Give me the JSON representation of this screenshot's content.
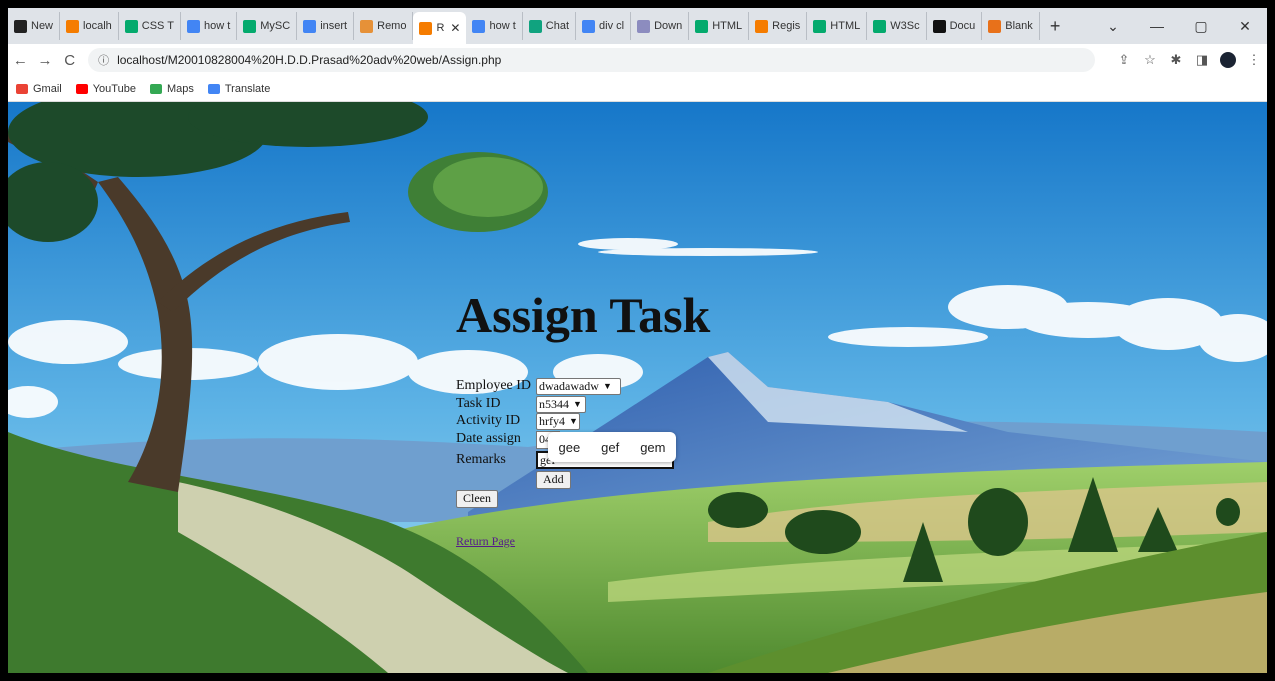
{
  "browser": {
    "tabs": [
      {
        "label": "New",
        "icon": "github-icon",
        "color": "#222222"
      },
      {
        "label": "localh",
        "icon": "xampp-icon",
        "color": "#f57c00"
      },
      {
        "label": "CSS T",
        "icon": "w3schools-icon",
        "color": "#04aa6d"
      },
      {
        "label": "how t",
        "icon": "google-icon",
        "color": "#4285f4"
      },
      {
        "label": "MySC",
        "icon": "w3schools-icon",
        "color": "#04aa6d"
      },
      {
        "label": "insert",
        "icon": "google-icon",
        "color": "#4285f4"
      },
      {
        "label": "Remo",
        "icon": "pen-icon",
        "color": "#e69138"
      },
      {
        "label": "R",
        "icon": "xampp-icon",
        "color": "#f57c00",
        "active": true
      },
      {
        "label": "how t",
        "icon": "google-icon",
        "color": "#4285f4"
      },
      {
        "label": "Chat",
        "icon": "chatgpt-icon",
        "color": "#10a37f"
      },
      {
        "label": "div cl",
        "icon": "google-icon",
        "color": "#4285f4"
      },
      {
        "label": "Down",
        "icon": "wave-icon",
        "color": "#8c8cbf"
      },
      {
        "label": "HTML",
        "icon": "w3schools-icon",
        "color": "#04aa6d"
      },
      {
        "label": "Regis",
        "icon": "xampp-icon",
        "color": "#f57c00"
      },
      {
        "label": "HTML",
        "icon": "w3schools-icon",
        "color": "#04aa6d"
      },
      {
        "label": "W3Sc",
        "icon": "w3schools-icon",
        "color": "#04aa6d"
      },
      {
        "label": "Docu",
        "icon": "doc-icon",
        "color": "#111111"
      },
      {
        "label": "Blank",
        "icon": "blank-icon",
        "color": "#e8711a"
      }
    ],
    "new_tab": "+",
    "window": {
      "menu": "⌄",
      "minimize": "—",
      "maximize": "▢",
      "close": "✕"
    },
    "nav": {
      "back": "←",
      "forward": "→",
      "reload": "C"
    },
    "url": "localhost/M20010828004%20H.D.D.Prasad%20adv%20web/Assign.php",
    "info_icon": "ⓘ",
    "toolbar_icons": {
      "share": "⇪",
      "star": "☆",
      "extensions": "✱",
      "sidepanel": "◨",
      "menu": "⋮"
    },
    "bookmarks": [
      {
        "label": "Gmail",
        "color": "#ea4335"
      },
      {
        "label": "YouTube",
        "color": "#ff0000"
      },
      {
        "label": "Maps",
        "color": "#34a853"
      },
      {
        "label": "Translate",
        "color": "#4285f4"
      }
    ]
  },
  "page": {
    "title": "Assign Task",
    "form": {
      "employee_label": "Employee ID",
      "employee_value": "dwadawadw",
      "task_label": "Task ID",
      "task_value": "n5344",
      "activity_label": "Activity ID",
      "activity_value": "hrfy4",
      "date_label": "Date assign",
      "date_value": "04,",
      "remarks_label": "Remarks",
      "remarks_value": "gef",
      "add_button": "Add",
      "clean_button": "Cleen"
    },
    "autocomplete": [
      "gee",
      "gef",
      "gem"
    ],
    "link_text": "Return Page"
  },
  "colors": {
    "sky_top": "#1a7fd0",
    "sky_bottom": "#8fd0f0",
    "grass": "#6aa84f"
  }
}
